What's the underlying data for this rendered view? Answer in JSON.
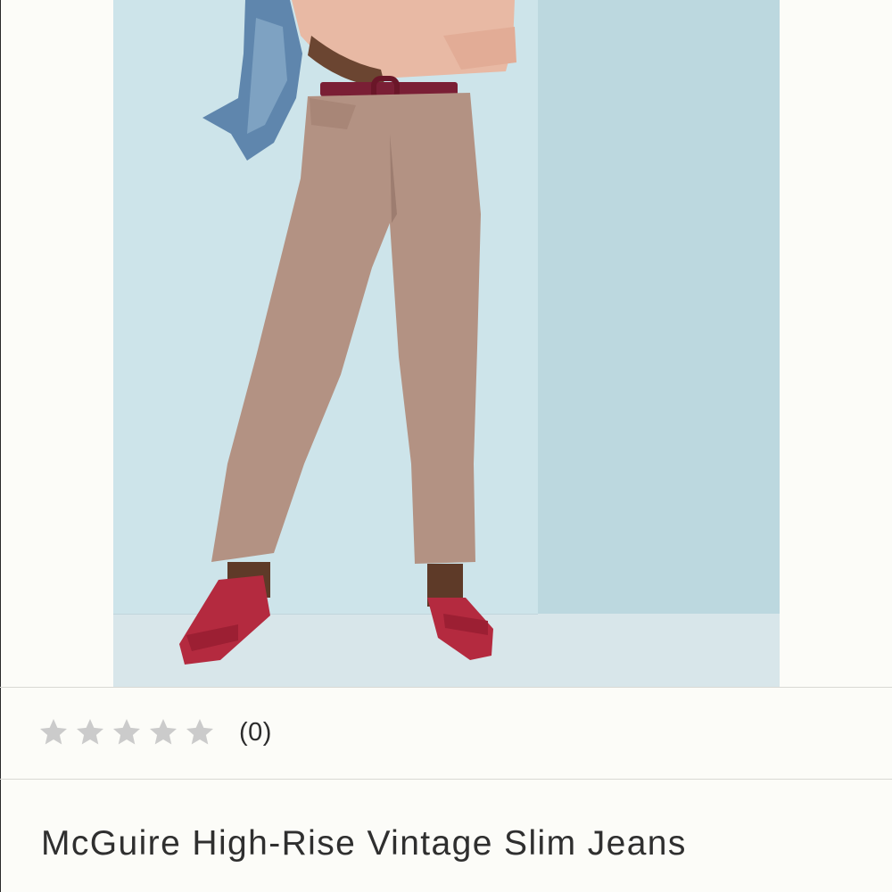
{
  "product": {
    "image_icon": "product-photo",
    "rating": {
      "stars_total": 5,
      "stars_filled": 0,
      "star_color": "#cbcbcb",
      "count_text": "(0)"
    },
    "title": "McGuire High-Rise Vintage Slim Jeans"
  },
  "colors": {
    "background": "#fcfcf8",
    "text": "#2f2f2f",
    "divider": "#d9d9d4",
    "photo_backdrop": "#c4dde4"
  }
}
